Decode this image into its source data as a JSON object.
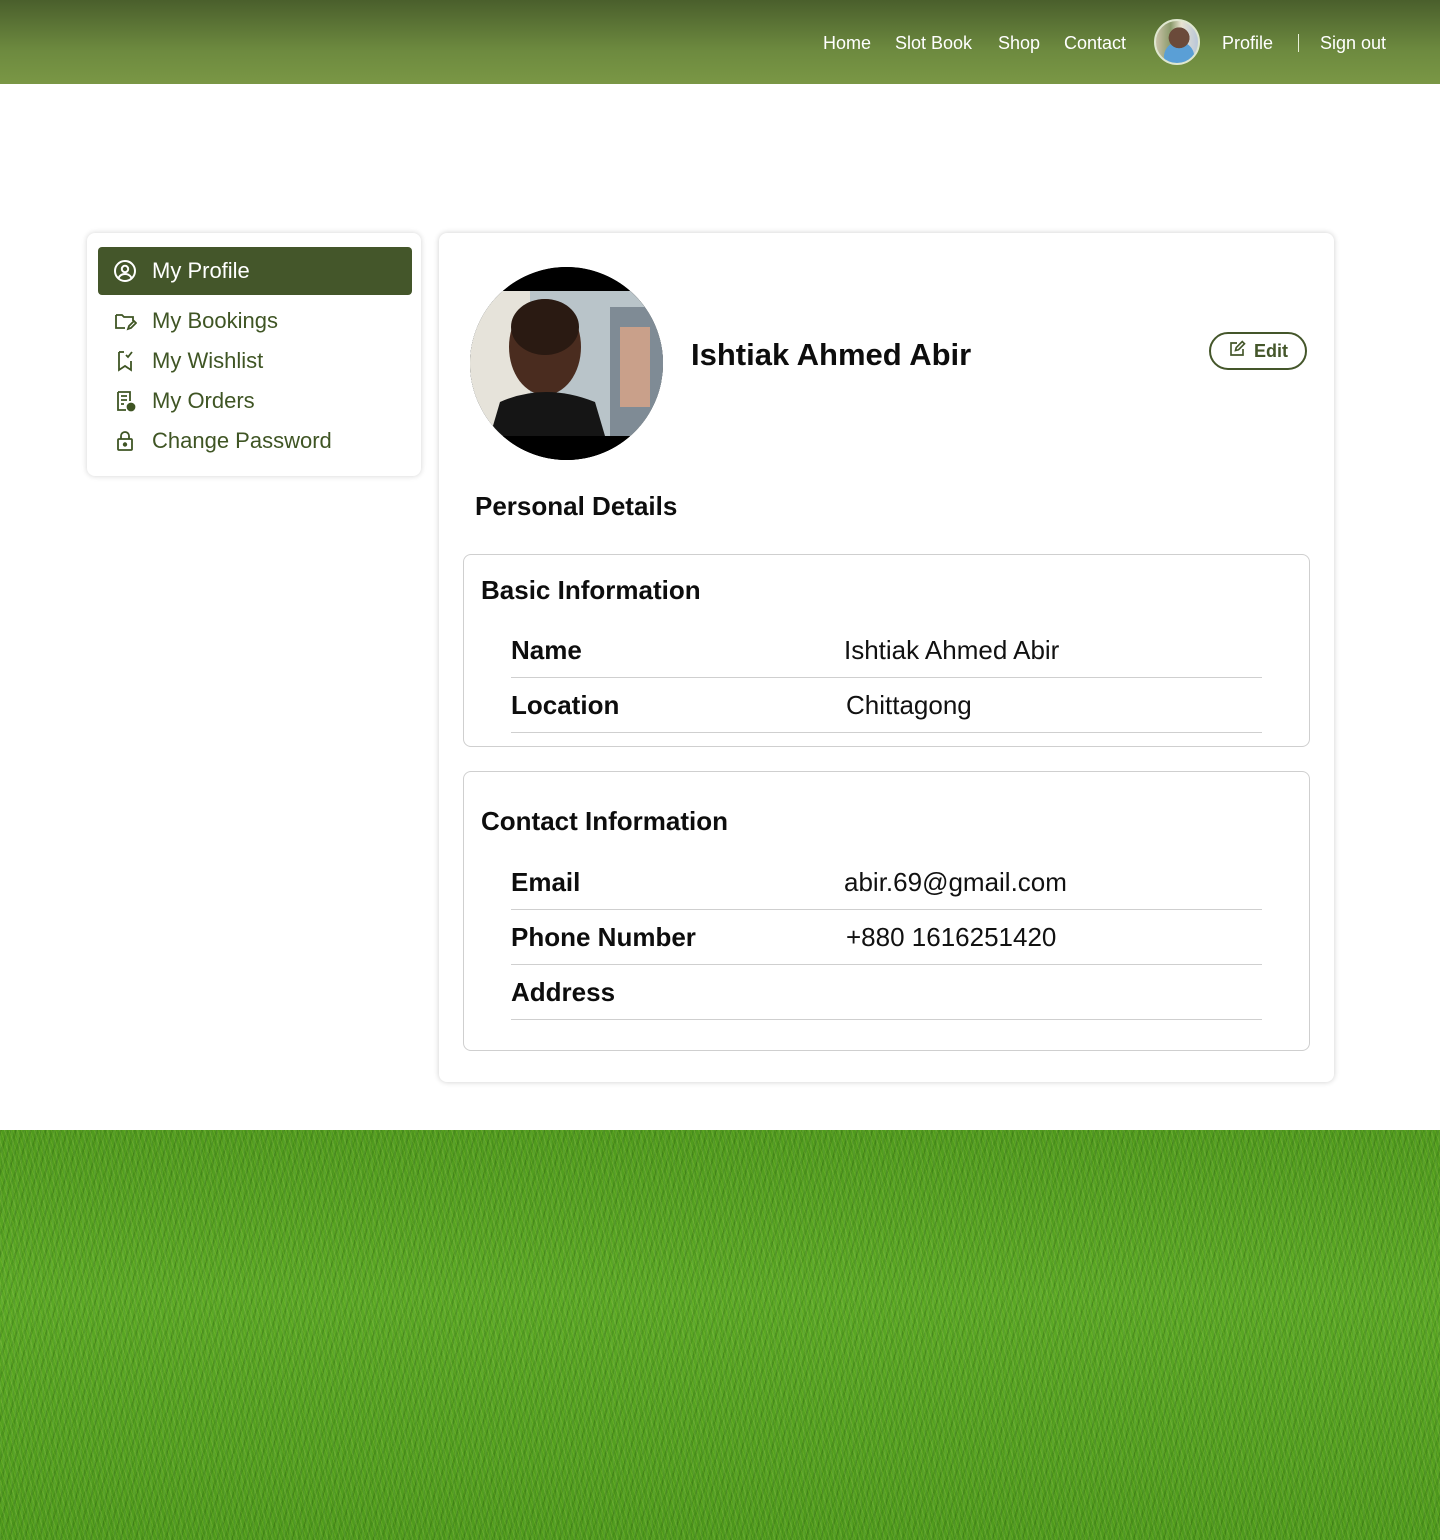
{
  "nav": {
    "home": "Home",
    "slot_book": "Slot Book",
    "shop": "Shop",
    "contact": "Contact",
    "profile": "Profile",
    "sign_out": "Sign out"
  },
  "sidebar": {
    "items": [
      {
        "label": "My Profile",
        "icon": "user-circle-icon",
        "active": true
      },
      {
        "label": "My Bookings",
        "icon": "folder-edit-icon",
        "active": false
      },
      {
        "label": "My Wishlist",
        "icon": "bookmark-check-icon",
        "active": false
      },
      {
        "label": "My Orders",
        "icon": "receipt-icon",
        "active": false
      },
      {
        "label": "Change Password",
        "icon": "lock-icon",
        "active": false
      }
    ]
  },
  "profile": {
    "name": "Ishtiak Ahmed Abir",
    "edit_label": "Edit",
    "section_title": "Personal Details"
  },
  "basic_info": {
    "title": "Basic Information",
    "rows": [
      {
        "label": "Name",
        "value": "Ishtiak Ahmed Abir"
      },
      {
        "label": "Location",
        "value": "Chittagong"
      }
    ]
  },
  "contact_info": {
    "title": "Contact Information",
    "rows": [
      {
        "label": "Email",
        "value": "abir.69@gmail.com"
      },
      {
        "label": "Phone Number",
        "value": "+880 1616251420"
      },
      {
        "label": "Address",
        "value": ""
      }
    ]
  },
  "colors": {
    "brand_dark": "#44562a",
    "header_top": "#4a5f2c",
    "header_bottom": "#7a9745",
    "grass": "#5aa826"
  }
}
